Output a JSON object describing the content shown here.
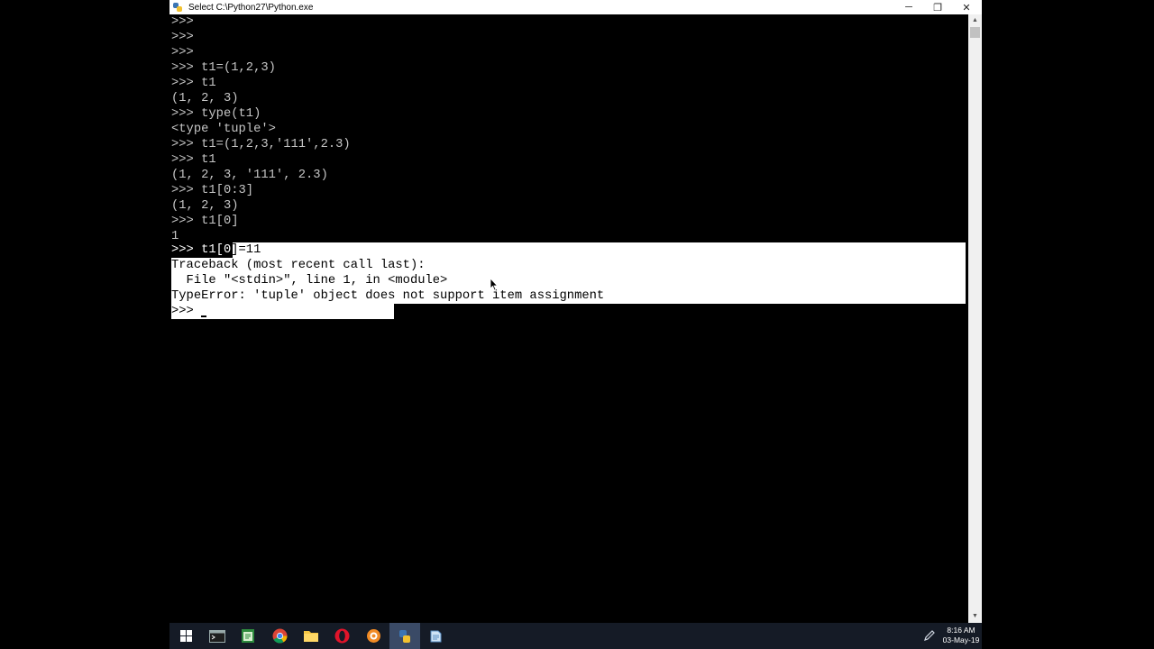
{
  "window": {
    "title": "Select C:\\Python27\\Python.exe",
    "minimize_glyph": "─",
    "restore_glyph": "❐",
    "close_glyph": "✕"
  },
  "console": {
    "lines": [
      ">>>",
      ">>>",
      ">>>",
      ">>> t1=(1,2,3)",
      ">>> t1",
      "(1, 2, 3)",
      ">>> type(t1)",
      "<type 'tuple'>",
      ">>> t1=(1,2,3,'111',2.3)",
      ">>> t1",
      "(1, 2, 3, '111', 2.3)",
      ">>> t1[0:3]",
      "(1, 2, 3)",
      ">>> t1[0]",
      "1",
      ">>> t1[0]=11",
      "Traceback (most recent call last):",
      "  File \"<stdin>\", line 1, in <module>",
      "TypeError: 'tuple' object does not support item assignment",
      ">>> "
    ],
    "selected_lines": [
      15,
      16,
      17,
      18,
      19
    ]
  },
  "taskbar": {
    "icons": [
      "windows-start-icon",
      "terminal-icon",
      "notepad-icon",
      "chrome-icon",
      "folder-icon",
      "opera-icon",
      "settings-icon",
      "python-icon",
      "idle-icon"
    ],
    "clock_time": "8:16 AM",
    "clock_date": "03-May-19"
  }
}
